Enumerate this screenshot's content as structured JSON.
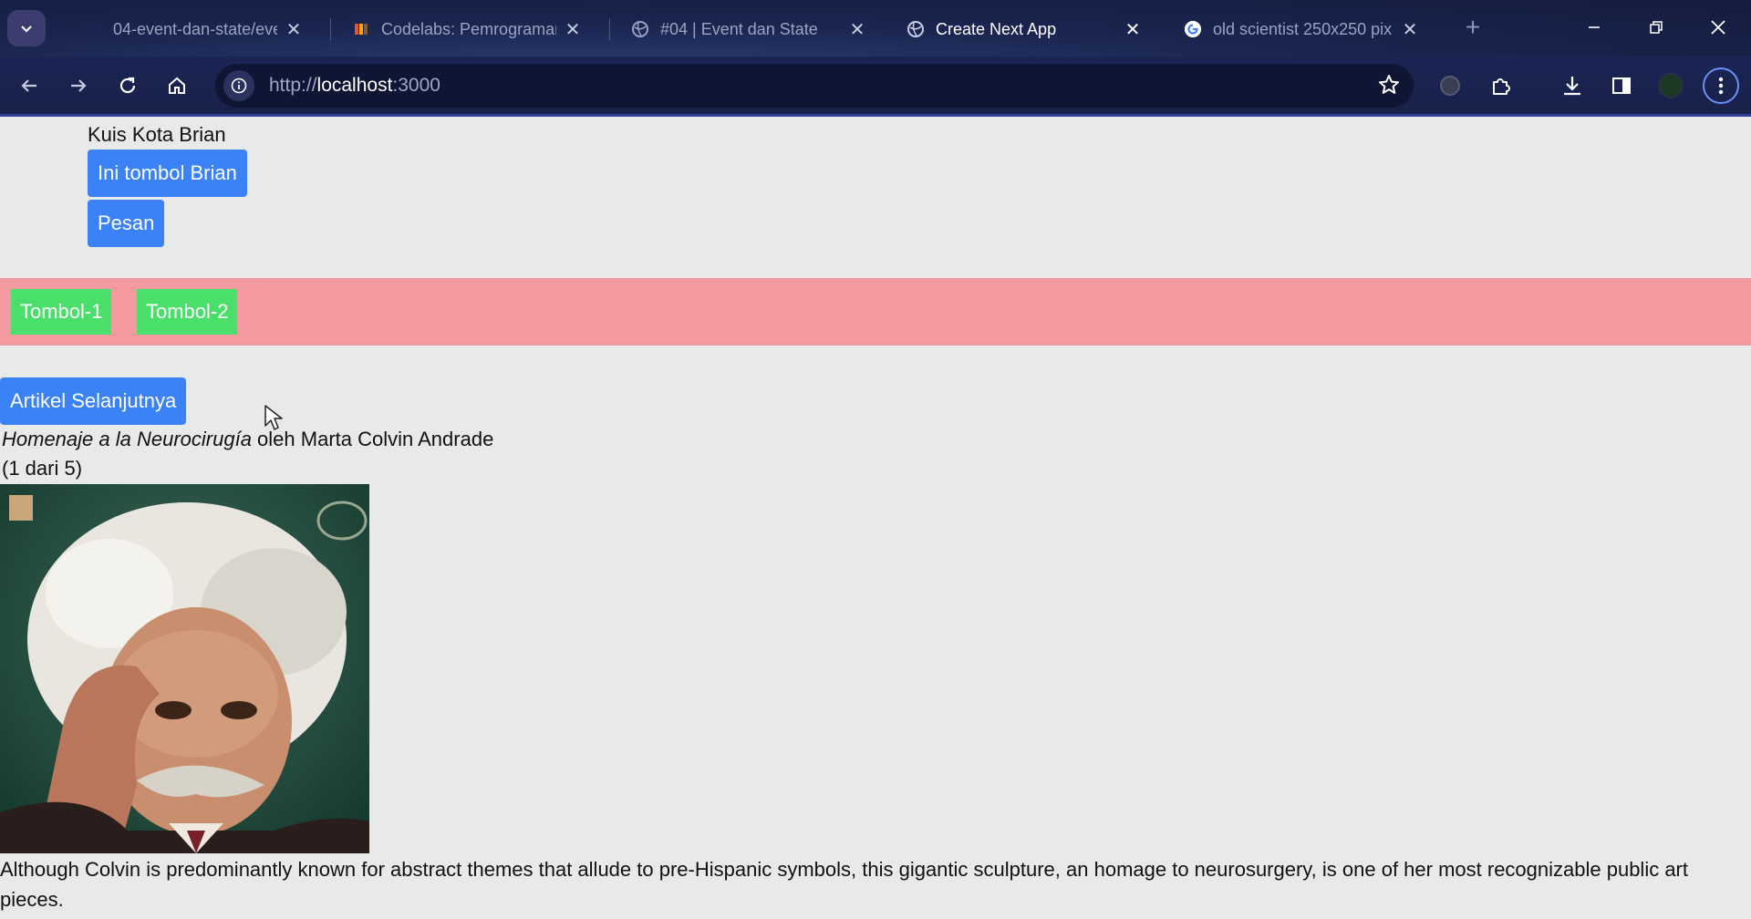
{
  "browser": {
    "tabs": [
      {
        "title": "04-event-dan-state/even",
        "favicon": "github-icon"
      },
      {
        "title": "Codelabs: Pemrograman",
        "favicon": "codelabs-icon"
      },
      {
        "title": "#04 | Event dan State",
        "favicon": "globe-icon"
      },
      {
        "title": "Create Next App",
        "favicon": "globe-icon",
        "active": true
      },
      {
        "title": "old scientist 250x250 pix",
        "favicon": "google-icon"
      }
    ],
    "url_scheme": "http://",
    "url_host": "localhost",
    "url_port": ":3000"
  },
  "page": {
    "quiz_title": "Kuis Kota Brian",
    "brian_button": "Ini tombol Brian",
    "message_button": "Pesan",
    "toolbar_buttons": [
      "Tombol-1",
      "Tombol-2"
    ],
    "next_article_button": "Artikel Selanjutnya",
    "artwork": {
      "title": "Homenaje a la Neurocirugía",
      "by_text": " oleh Marta Colvin Andrade",
      "counter": "(1 dari 5)",
      "description": "Although Colvin is predominantly known for abstract themes that allude to pre-Hispanic symbols, this gigantic sculpture, an homage to neurosurgery, is one of her most recognizable public art pieces."
    }
  },
  "colors": {
    "primary_button": "#3b82f6",
    "success_button": "#4ade6a",
    "pink_bar": "#f29aa0"
  }
}
